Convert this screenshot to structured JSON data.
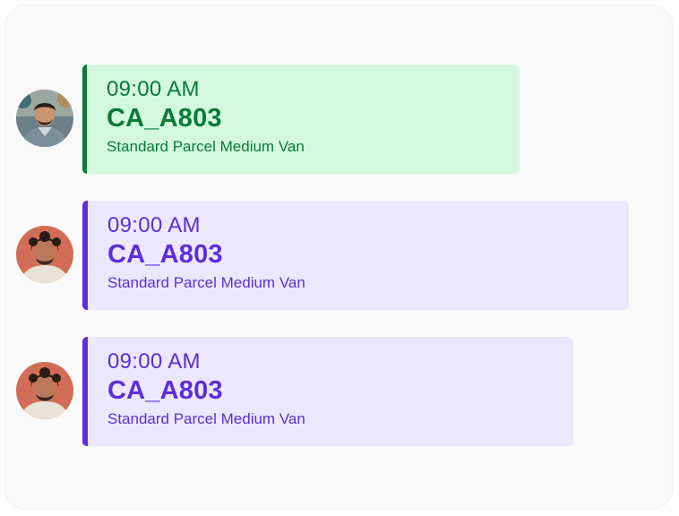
{
  "schedule": [
    {
      "time": "09:00 AM",
      "code": "CA_A803",
      "description": "Standard Parcel Medium Van",
      "accent": "#0a7a3a",
      "background": "#d3f8de",
      "avatar": "man-with-beard-avatar"
    },
    {
      "time": "09:00 AM",
      "code": "CA_A803",
      "description": "Standard Parcel Medium Van",
      "accent": "#5d2ee0",
      "background": "#ebe8fd",
      "avatar": "curly-haired-man-avatar"
    },
    {
      "time": "09:00 AM",
      "code": "CA_A803",
      "description": "Standard Parcel Medium Van",
      "accent": "#5d2ee0",
      "background": "#ebe8fd",
      "avatar": "curly-haired-man-avatar"
    }
  ]
}
